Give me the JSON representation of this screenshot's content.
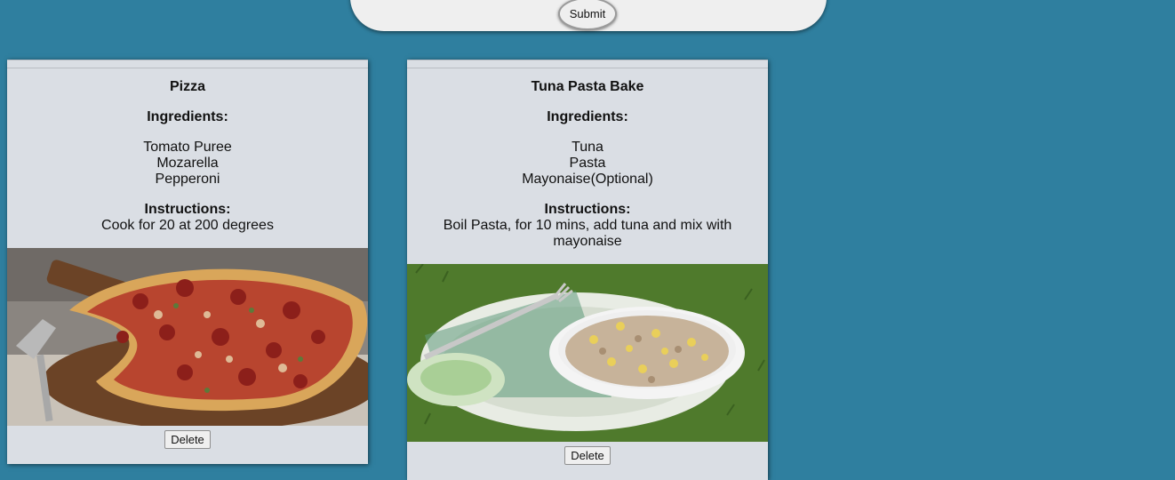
{
  "form": {
    "submit_label": "Submit"
  },
  "recipes": [
    {
      "title": "Pizza",
      "ingredients_heading": "Ingredients:",
      "ingredients": [
        "Tomato Puree",
        "Mozarella",
        "Pepperoni"
      ],
      "instructions_heading": "Instructions:",
      "instructions": "Cook for 20 at 200 degrees",
      "delete_label": "Delete"
    },
    {
      "title": "Tuna Pasta Bake",
      "ingredients_heading": "Ingredients:",
      "ingredients": [
        "Tuna",
        "Pasta",
        "Mayonaise(Optional)"
      ],
      "instructions_heading": "Instructions:",
      "instructions": "Boil Pasta, for 10 mins, add tuna and mix with mayonaise",
      "delete_label": "Delete"
    }
  ],
  "colors": {
    "background": "#2f7f9f",
    "card": "#dadee4",
    "form_panel": "#efefef"
  }
}
